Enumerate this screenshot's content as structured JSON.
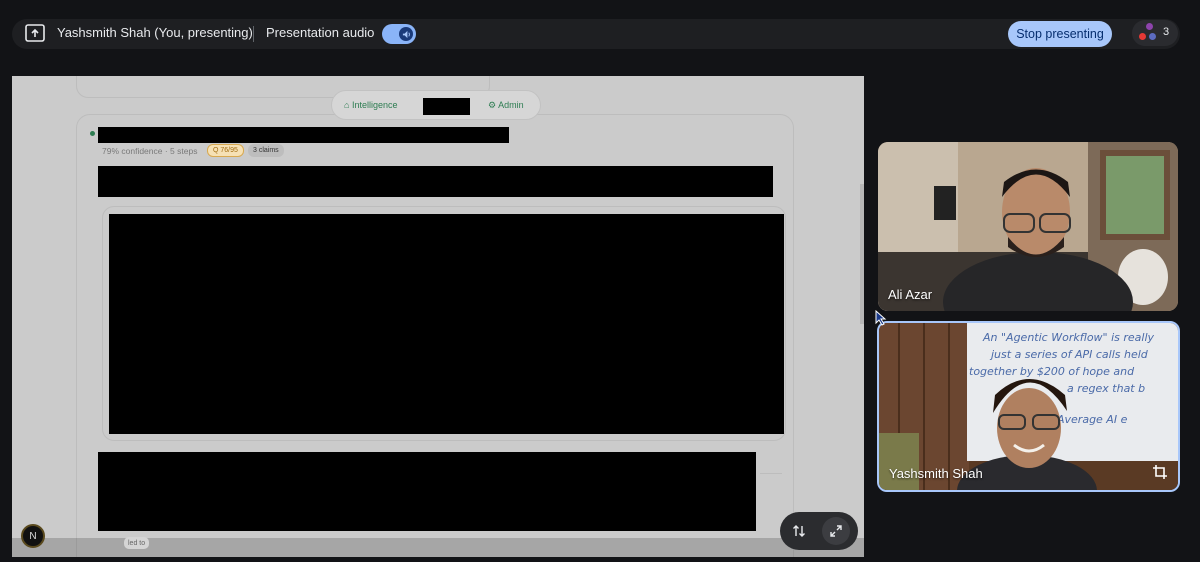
{
  "topbar": {
    "present_icon": "present-screen-icon",
    "presenter_name": "Yashsmith Shah (You, presenting)",
    "audio_label": "Presentation audio",
    "audio_icon": "speaker-icon",
    "stop_label": "Stop presenting",
    "participant_count": "3",
    "accent": "#a8c7fa"
  },
  "shared_screen": {
    "nav": {
      "intelligence_label": "Intelligence",
      "admin_label": "Admin"
    },
    "card": {
      "meta": "79% confidence · 5 steps",
      "quality_badge": "Q 76/95",
      "claims_badge": "3 claims",
      "footer_chip": "led to"
    },
    "avatar_letter": "N"
  },
  "tiles": [
    {
      "name": "Ali Azar"
    },
    {
      "name": "Yashsmith Shah",
      "whiteboard_text": "An \"Agentic Workflow\" is really just a series of API calls held together by $200 of hope and a regex that b... Average AI e..."
    }
  ]
}
